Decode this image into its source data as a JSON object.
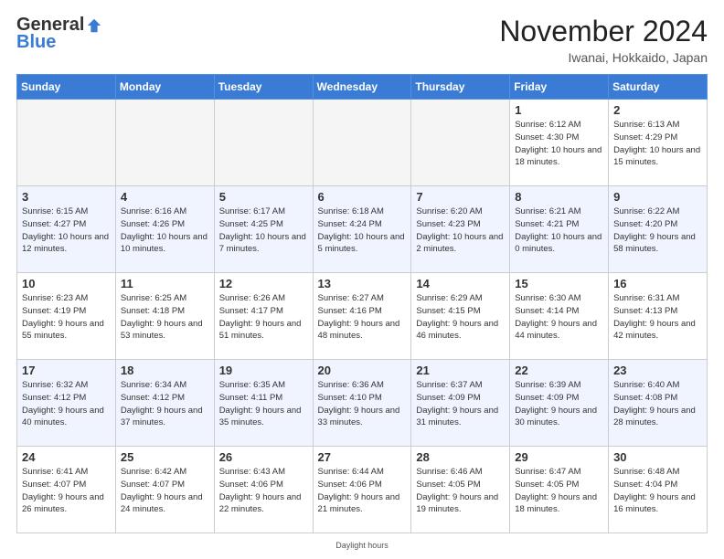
{
  "header": {
    "logo_general": "General",
    "logo_blue": "Blue",
    "month_title": "November 2024",
    "location": "Iwanai, Hokkaido, Japan"
  },
  "days_of_week": [
    "Sunday",
    "Monday",
    "Tuesday",
    "Wednesday",
    "Thursday",
    "Friday",
    "Saturday"
  ],
  "weeks": [
    {
      "days": [
        {
          "num": "",
          "empty": true
        },
        {
          "num": "",
          "empty": true
        },
        {
          "num": "",
          "empty": true
        },
        {
          "num": "",
          "empty": true
        },
        {
          "num": "",
          "empty": true
        },
        {
          "num": "1",
          "sunrise": "6:12 AM",
          "sunset": "4:30 PM",
          "daylight": "10 hours and 18 minutes."
        },
        {
          "num": "2",
          "sunrise": "6:13 AM",
          "sunset": "4:29 PM",
          "daylight": "10 hours and 15 minutes."
        }
      ]
    },
    {
      "days": [
        {
          "num": "3",
          "sunrise": "6:15 AM",
          "sunset": "4:27 PM",
          "daylight": "10 hours and 12 minutes."
        },
        {
          "num": "4",
          "sunrise": "6:16 AM",
          "sunset": "4:26 PM",
          "daylight": "10 hours and 10 minutes."
        },
        {
          "num": "5",
          "sunrise": "6:17 AM",
          "sunset": "4:25 PM",
          "daylight": "10 hours and 7 minutes."
        },
        {
          "num": "6",
          "sunrise": "6:18 AM",
          "sunset": "4:24 PM",
          "daylight": "10 hours and 5 minutes."
        },
        {
          "num": "7",
          "sunrise": "6:20 AM",
          "sunset": "4:23 PM",
          "daylight": "10 hours and 2 minutes."
        },
        {
          "num": "8",
          "sunrise": "6:21 AM",
          "sunset": "4:21 PM",
          "daylight": "10 hours and 0 minutes."
        },
        {
          "num": "9",
          "sunrise": "6:22 AM",
          "sunset": "4:20 PM",
          "daylight": "9 hours and 58 minutes."
        }
      ]
    },
    {
      "days": [
        {
          "num": "10",
          "sunrise": "6:23 AM",
          "sunset": "4:19 PM",
          "daylight": "9 hours and 55 minutes."
        },
        {
          "num": "11",
          "sunrise": "6:25 AM",
          "sunset": "4:18 PM",
          "daylight": "9 hours and 53 minutes."
        },
        {
          "num": "12",
          "sunrise": "6:26 AM",
          "sunset": "4:17 PM",
          "daylight": "9 hours and 51 minutes."
        },
        {
          "num": "13",
          "sunrise": "6:27 AM",
          "sunset": "4:16 PM",
          "daylight": "9 hours and 48 minutes."
        },
        {
          "num": "14",
          "sunrise": "6:29 AM",
          "sunset": "4:15 PM",
          "daylight": "9 hours and 46 minutes."
        },
        {
          "num": "15",
          "sunrise": "6:30 AM",
          "sunset": "4:14 PM",
          "daylight": "9 hours and 44 minutes."
        },
        {
          "num": "16",
          "sunrise": "6:31 AM",
          "sunset": "4:13 PM",
          "daylight": "9 hours and 42 minutes."
        }
      ]
    },
    {
      "days": [
        {
          "num": "17",
          "sunrise": "6:32 AM",
          "sunset": "4:12 PM",
          "daylight": "9 hours and 40 minutes."
        },
        {
          "num": "18",
          "sunrise": "6:34 AM",
          "sunset": "4:12 PM",
          "daylight": "9 hours and 37 minutes."
        },
        {
          "num": "19",
          "sunrise": "6:35 AM",
          "sunset": "4:11 PM",
          "daylight": "9 hours and 35 minutes."
        },
        {
          "num": "20",
          "sunrise": "6:36 AM",
          "sunset": "4:10 PM",
          "daylight": "9 hours and 33 minutes."
        },
        {
          "num": "21",
          "sunrise": "6:37 AM",
          "sunset": "4:09 PM",
          "daylight": "9 hours and 31 minutes."
        },
        {
          "num": "22",
          "sunrise": "6:39 AM",
          "sunset": "4:09 PM",
          "daylight": "9 hours and 30 minutes."
        },
        {
          "num": "23",
          "sunrise": "6:40 AM",
          "sunset": "4:08 PM",
          "daylight": "9 hours and 28 minutes."
        }
      ]
    },
    {
      "days": [
        {
          "num": "24",
          "sunrise": "6:41 AM",
          "sunset": "4:07 PM",
          "daylight": "9 hours and 26 minutes."
        },
        {
          "num": "25",
          "sunrise": "6:42 AM",
          "sunset": "4:07 PM",
          "daylight": "9 hours and 24 minutes."
        },
        {
          "num": "26",
          "sunrise": "6:43 AM",
          "sunset": "4:06 PM",
          "daylight": "9 hours and 22 minutes."
        },
        {
          "num": "27",
          "sunrise": "6:44 AM",
          "sunset": "4:06 PM",
          "daylight": "9 hours and 21 minutes."
        },
        {
          "num": "28",
          "sunrise": "6:46 AM",
          "sunset": "4:05 PM",
          "daylight": "9 hours and 19 minutes."
        },
        {
          "num": "29",
          "sunrise": "6:47 AM",
          "sunset": "4:05 PM",
          "daylight": "9 hours and 18 minutes."
        },
        {
          "num": "30",
          "sunrise": "6:48 AM",
          "sunset": "4:04 PM",
          "daylight": "9 hours and 16 minutes."
        }
      ]
    }
  ],
  "daylight_label": "Daylight hours"
}
